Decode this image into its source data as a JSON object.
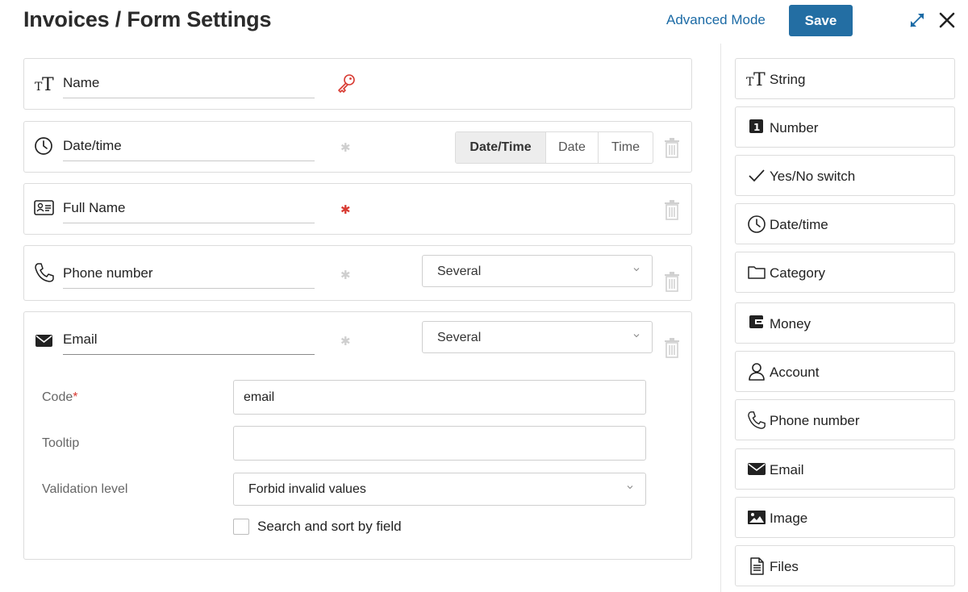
{
  "header": {
    "title": "Invoices / Form Settings",
    "advanced_mode_label": "Advanced Mode",
    "save_label": "Save"
  },
  "fields": [
    {
      "name": "Name",
      "icon": "text-type-icon",
      "indicator": "key-icon"
    },
    {
      "name": "Date/time",
      "icon": "clock-icon",
      "indicator": "required-star-inactive",
      "modes": [
        "Date/Time",
        "Date",
        "Time"
      ],
      "selected_mode": "Date/Time"
    },
    {
      "name": "Full Name",
      "icon": "id-card-icon",
      "indicator": "required-star-active"
    },
    {
      "name": "Phone number",
      "icon": "phone-icon",
      "indicator": "required-star-inactive",
      "multiplicity": "Several"
    },
    {
      "name": "Email",
      "icon": "envelope-icon",
      "indicator": "required-star-inactive",
      "multiplicity": "Several"
    }
  ],
  "email_props": {
    "code_label": "Code",
    "code_required_mark": "*",
    "code_value": "email",
    "tooltip_label": "Tooltip",
    "tooltip_value": "",
    "validation_label": "Validation level",
    "validation_value": "Forbid invalid values",
    "search_sort_label": "Search and sort by field",
    "search_sort_checked": false
  },
  "required_mark": "✱",
  "field_types": [
    {
      "label": "String",
      "icon": "text-type-icon"
    },
    {
      "label": "Number",
      "icon": "number-icon"
    },
    {
      "label": "Yes/No switch",
      "icon": "checkmark-icon"
    },
    {
      "label": "Date/time",
      "icon": "clock-icon"
    },
    {
      "label": "Category",
      "icon": "folder-icon"
    },
    {
      "label": "Money",
      "icon": "wallet-icon"
    },
    {
      "label": "Account",
      "icon": "user-icon"
    },
    {
      "label": "Phone number",
      "icon": "phone-icon"
    },
    {
      "label": "Email",
      "icon": "envelope-icon"
    },
    {
      "label": "Image",
      "icon": "image-icon"
    },
    {
      "label": "Files",
      "icon": "file-icon"
    }
  ],
  "colors": {
    "accent": "#236ea3",
    "link": "#1b6aa5",
    "required_active": "#d83a32",
    "required_inactive": "#cfcfcf",
    "key_icon": "#d83a32"
  }
}
